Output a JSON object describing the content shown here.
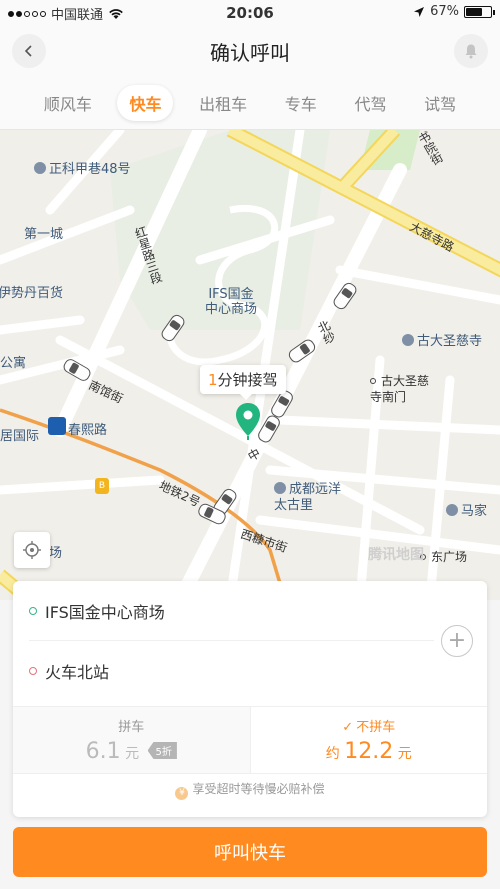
{
  "status_bar": {
    "carrier": "中国联通",
    "time": "20:06",
    "battery": "67%",
    "battery_level": 0.67
  },
  "nav": {
    "title": "确认呼叫",
    "back_icon": "chevron-left-icon",
    "bell_icon": "bell-icon"
  },
  "tabs": [
    {
      "label": "顺风车",
      "active": false
    },
    {
      "label": "快车",
      "active": true
    },
    {
      "label": "出租车",
      "active": false
    },
    {
      "label": "专车",
      "active": false
    },
    {
      "label": "代驾",
      "active": false
    },
    {
      "label": "试驾",
      "active": false
    }
  ],
  "map": {
    "labels": {
      "zhengke": "正科甲巷48号",
      "diyicheng": "第一城",
      "hongxing": "红星路三段",
      "shidan": "伊势丹百货",
      "ifs": "IFS国金\n中心商场",
      "gongyu": "公寓",
      "nanguan": "南馆街",
      "guoji": "居国际",
      "chunxi": "春熙路",
      "beisha": "北纱",
      "dacisi": "大慈寺路",
      "dacisi_temple": "古大圣慈寺",
      "temple_south_gate": "古大圣慈\n寺南门",
      "chengdu_yuanyang": "成都远洋\n太古里",
      "metro_line": "地铁2号",
      "xitang": "西糠市街",
      "majia": "马家",
      "dongguangchang": "东广场",
      "guangchang": "广场",
      "top_road": "书院街",
      "center_road": "中"
    },
    "eta_num": "1",
    "eta_text": "分钟接驾",
    "watermark": "腾讯地图",
    "bus_label": "B"
  },
  "card": {
    "from": "IFS国金中心商场",
    "to": "火车北站",
    "add_symbol": "+",
    "share": {
      "label": "拼车",
      "price": "6.1",
      "unit": "元",
      "discount": "5折"
    },
    "noshare": {
      "label": "不拼车",
      "prefix": "约",
      "price": "12.2",
      "unit": "元"
    },
    "guarantee": "享受超时等待慢必赔补偿",
    "guarantee_symbol": "¥"
  },
  "cta": {
    "label": "呼叫快车"
  },
  "colors": {
    "accent": "#ff8a1f",
    "origin_dot": "#3bb38a",
    "dest_dot": "#e2747a",
    "pin": "#22b57f",
    "arterial_road": "#f7e58a",
    "metro_line": "#f0a14a"
  }
}
